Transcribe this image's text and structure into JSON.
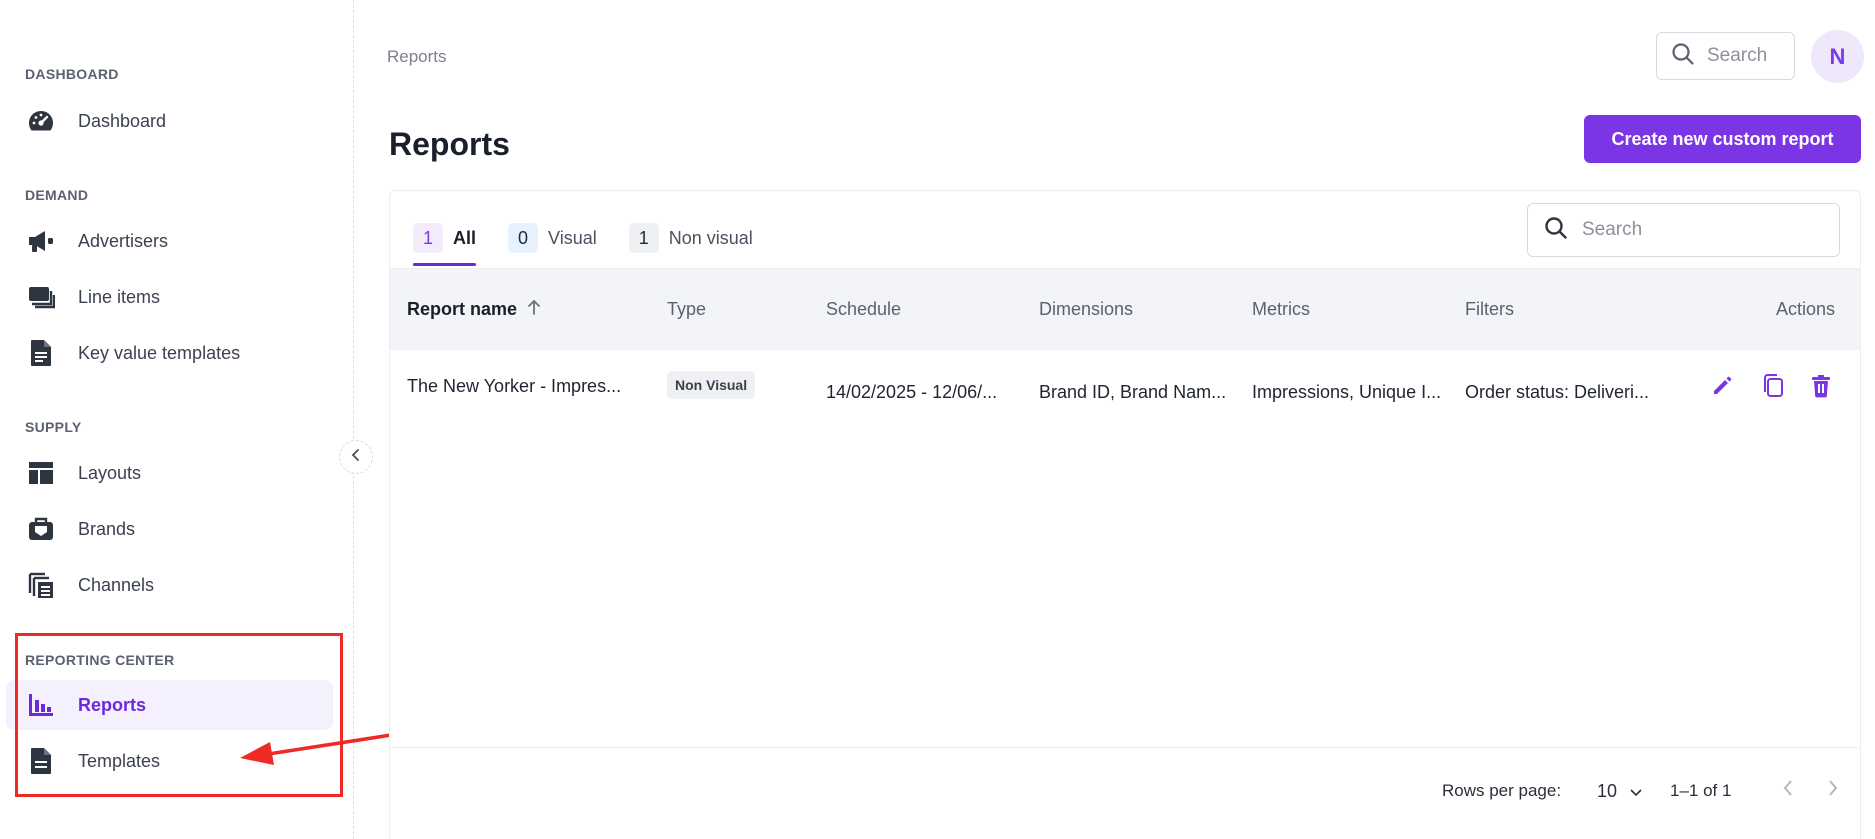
{
  "sidebar": {
    "sections": [
      {
        "title": "DASHBOARD",
        "items": [
          {
            "label": "Dashboard",
            "icon": "speedometer-icon"
          }
        ]
      },
      {
        "title": "DEMAND",
        "items": [
          {
            "label": "Advertisers",
            "icon": "megaphone-icon"
          },
          {
            "label": "Line items",
            "icon": "stack-icon"
          },
          {
            "label": "Key value templates",
            "icon": "document-icon"
          }
        ]
      },
      {
        "title": "SUPPLY",
        "items": [
          {
            "label": "Layouts",
            "icon": "layout-icon"
          },
          {
            "label": "Brands",
            "icon": "brand-icon"
          },
          {
            "label": "Channels",
            "icon": "channels-icon"
          }
        ]
      },
      {
        "title": "REPORTING CENTER",
        "items": [
          {
            "label": "Reports",
            "icon": "bar-chart-icon",
            "active": true
          },
          {
            "label": "Templates",
            "icon": "document-icon"
          }
        ]
      }
    ]
  },
  "header": {
    "breadcrumb": "Reports",
    "search_placeholder": "Search",
    "avatar_initial": "N"
  },
  "main": {
    "title": "Reports",
    "create_button": "Create new custom report",
    "tabs": [
      {
        "count": "1",
        "label": "All",
        "active": true
      },
      {
        "count": "0",
        "label": "Visual"
      },
      {
        "count": "1",
        "label": "Non visual"
      }
    ],
    "search_placeholder": "Search",
    "table": {
      "columns": [
        "Report name",
        "Type",
        "Schedule",
        "Dimensions",
        "Metrics",
        "Filters",
        "Actions"
      ],
      "rows": [
        {
          "name": "The New Yorker - Impres...",
          "type": "Non Visual",
          "schedule": "14/02/2025 - 12/06/...",
          "dimensions": "Brand ID, Brand Nam...",
          "metrics": "Impressions, Unique I...",
          "filters": "Order status: Deliveri..."
        }
      ]
    },
    "pagination": {
      "rows_label": "Rows per page:",
      "rows_value": "10",
      "range": "1–1 of 1"
    }
  },
  "colors": {
    "accent": "#7c35e4",
    "annotation": "#ee2a24"
  }
}
